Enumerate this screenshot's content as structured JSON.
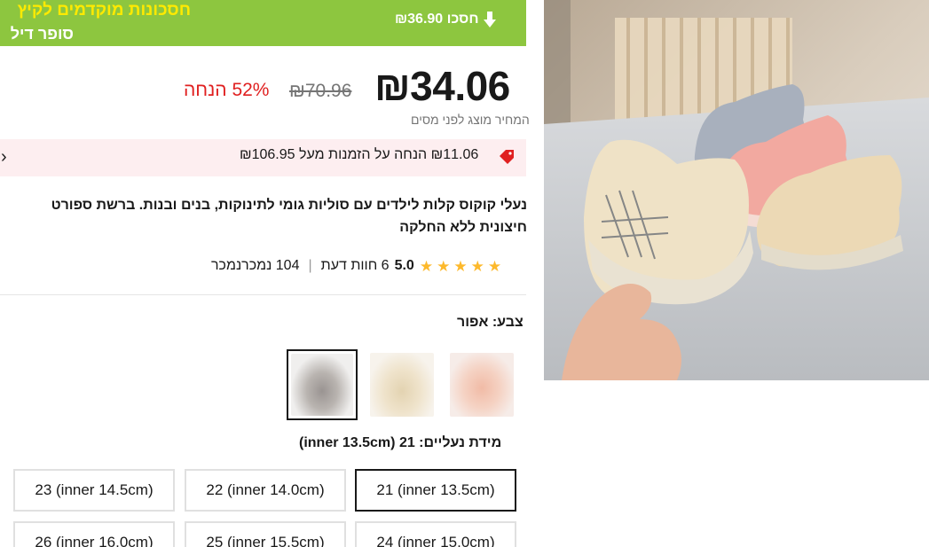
{
  "banner": {
    "title": "חסכונות מוקדמים לקיץ",
    "subtitle": "סופר דיל",
    "save_label": "₪36.90 חסכו"
  },
  "price": {
    "current": "₪34.06",
    "original": "₪70.96",
    "discount": "52% הנחה",
    "tax_note": "המחיר מוצג לפני מסים"
  },
  "coupon": {
    "text": "₪11.06 הנחה על הזמנות מעל ₪106.95"
  },
  "product": {
    "title": "נעלי קוקוס קלות לילדים עם סוליות גומי לתינוקות, בנים ובנות. ברשת ספורט חיצונית ללא החלקה"
  },
  "rating": {
    "score": "5.0",
    "reviews": "6 חוות דעת",
    "sold": "104 נמכרנמכר",
    "stars": 5
  },
  "color": {
    "label": "צבע: אפור",
    "options": [
      "gray",
      "beige",
      "pink"
    ],
    "selected": "gray"
  },
  "size": {
    "label": "מידת נעליים: 21 (inner 13.5cm)",
    "options": [
      "21 (inner 13.5cm)",
      "22 (inner 14.0cm)",
      "23 (inner 14.5cm)",
      "24 (inner 15.0cm)",
      "25 (inner 15.5cm)",
      "26 (inner 16.0cm)"
    ],
    "selected": "21 (inner 13.5cm)"
  },
  "colors": {
    "banner_bg": "#8dc63f",
    "banner_title": "#ffea00",
    "discount": "#e02020",
    "coupon_bg": "#fdeef0",
    "star": "#fdb92c"
  }
}
